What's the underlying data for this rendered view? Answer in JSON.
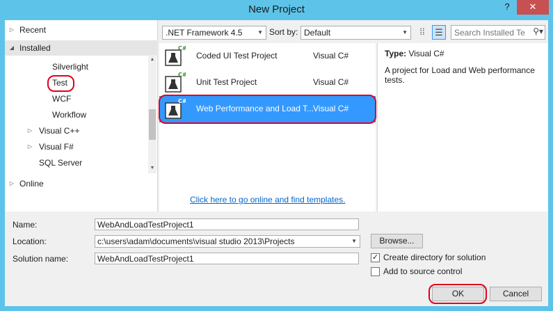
{
  "window": {
    "title": "New Project",
    "help_glyph": "?",
    "close_glyph": "✕"
  },
  "tree": {
    "recent": "Recent",
    "installed": "Installed",
    "silverlight": "Silverlight",
    "test": "Test",
    "wcf": "WCF",
    "workflow": "Workflow",
    "visual_cpp": "Visual C++",
    "visual_fsharp": "Visual F#",
    "sql_server": "SQL Server",
    "online": "Online"
  },
  "toolbar": {
    "framework": ".NET Framework 4.5",
    "sort_label": "Sort by:",
    "sort_value": "Default",
    "search_placeholder": "Search Installed Te"
  },
  "templates": [
    {
      "name": "Coded UI Test Project",
      "lang": "Visual C#"
    },
    {
      "name": "Unit Test Project",
      "lang": "Visual C#"
    },
    {
      "name": "Web Performance and Load T...",
      "lang": "Visual C#"
    }
  ],
  "online_link": "Click here to go online and find templates.",
  "description": {
    "type_label": "Type:",
    "type_value": "Visual C#",
    "text": "A project for Load and Web performance tests."
  },
  "form": {
    "name_label": "Name:",
    "name_value": "WebAndLoadTestProject1",
    "location_label": "Location:",
    "location_value": "c:\\users\\adam\\documents\\visual studio 2013\\Projects",
    "browse_label": "Browse...",
    "solution_label": "Solution name:",
    "solution_value": "WebAndLoadTestProject1",
    "create_dir_label": "Create directory for solution",
    "create_dir_checked": true,
    "source_control_label": "Add to source control",
    "source_control_checked": false,
    "ok_label": "OK",
    "cancel_label": "Cancel"
  },
  "colors": {
    "chrome": "#5ec3e8",
    "selection": "#3399ff",
    "annotation": "#e2001a",
    "close": "#c75050"
  }
}
